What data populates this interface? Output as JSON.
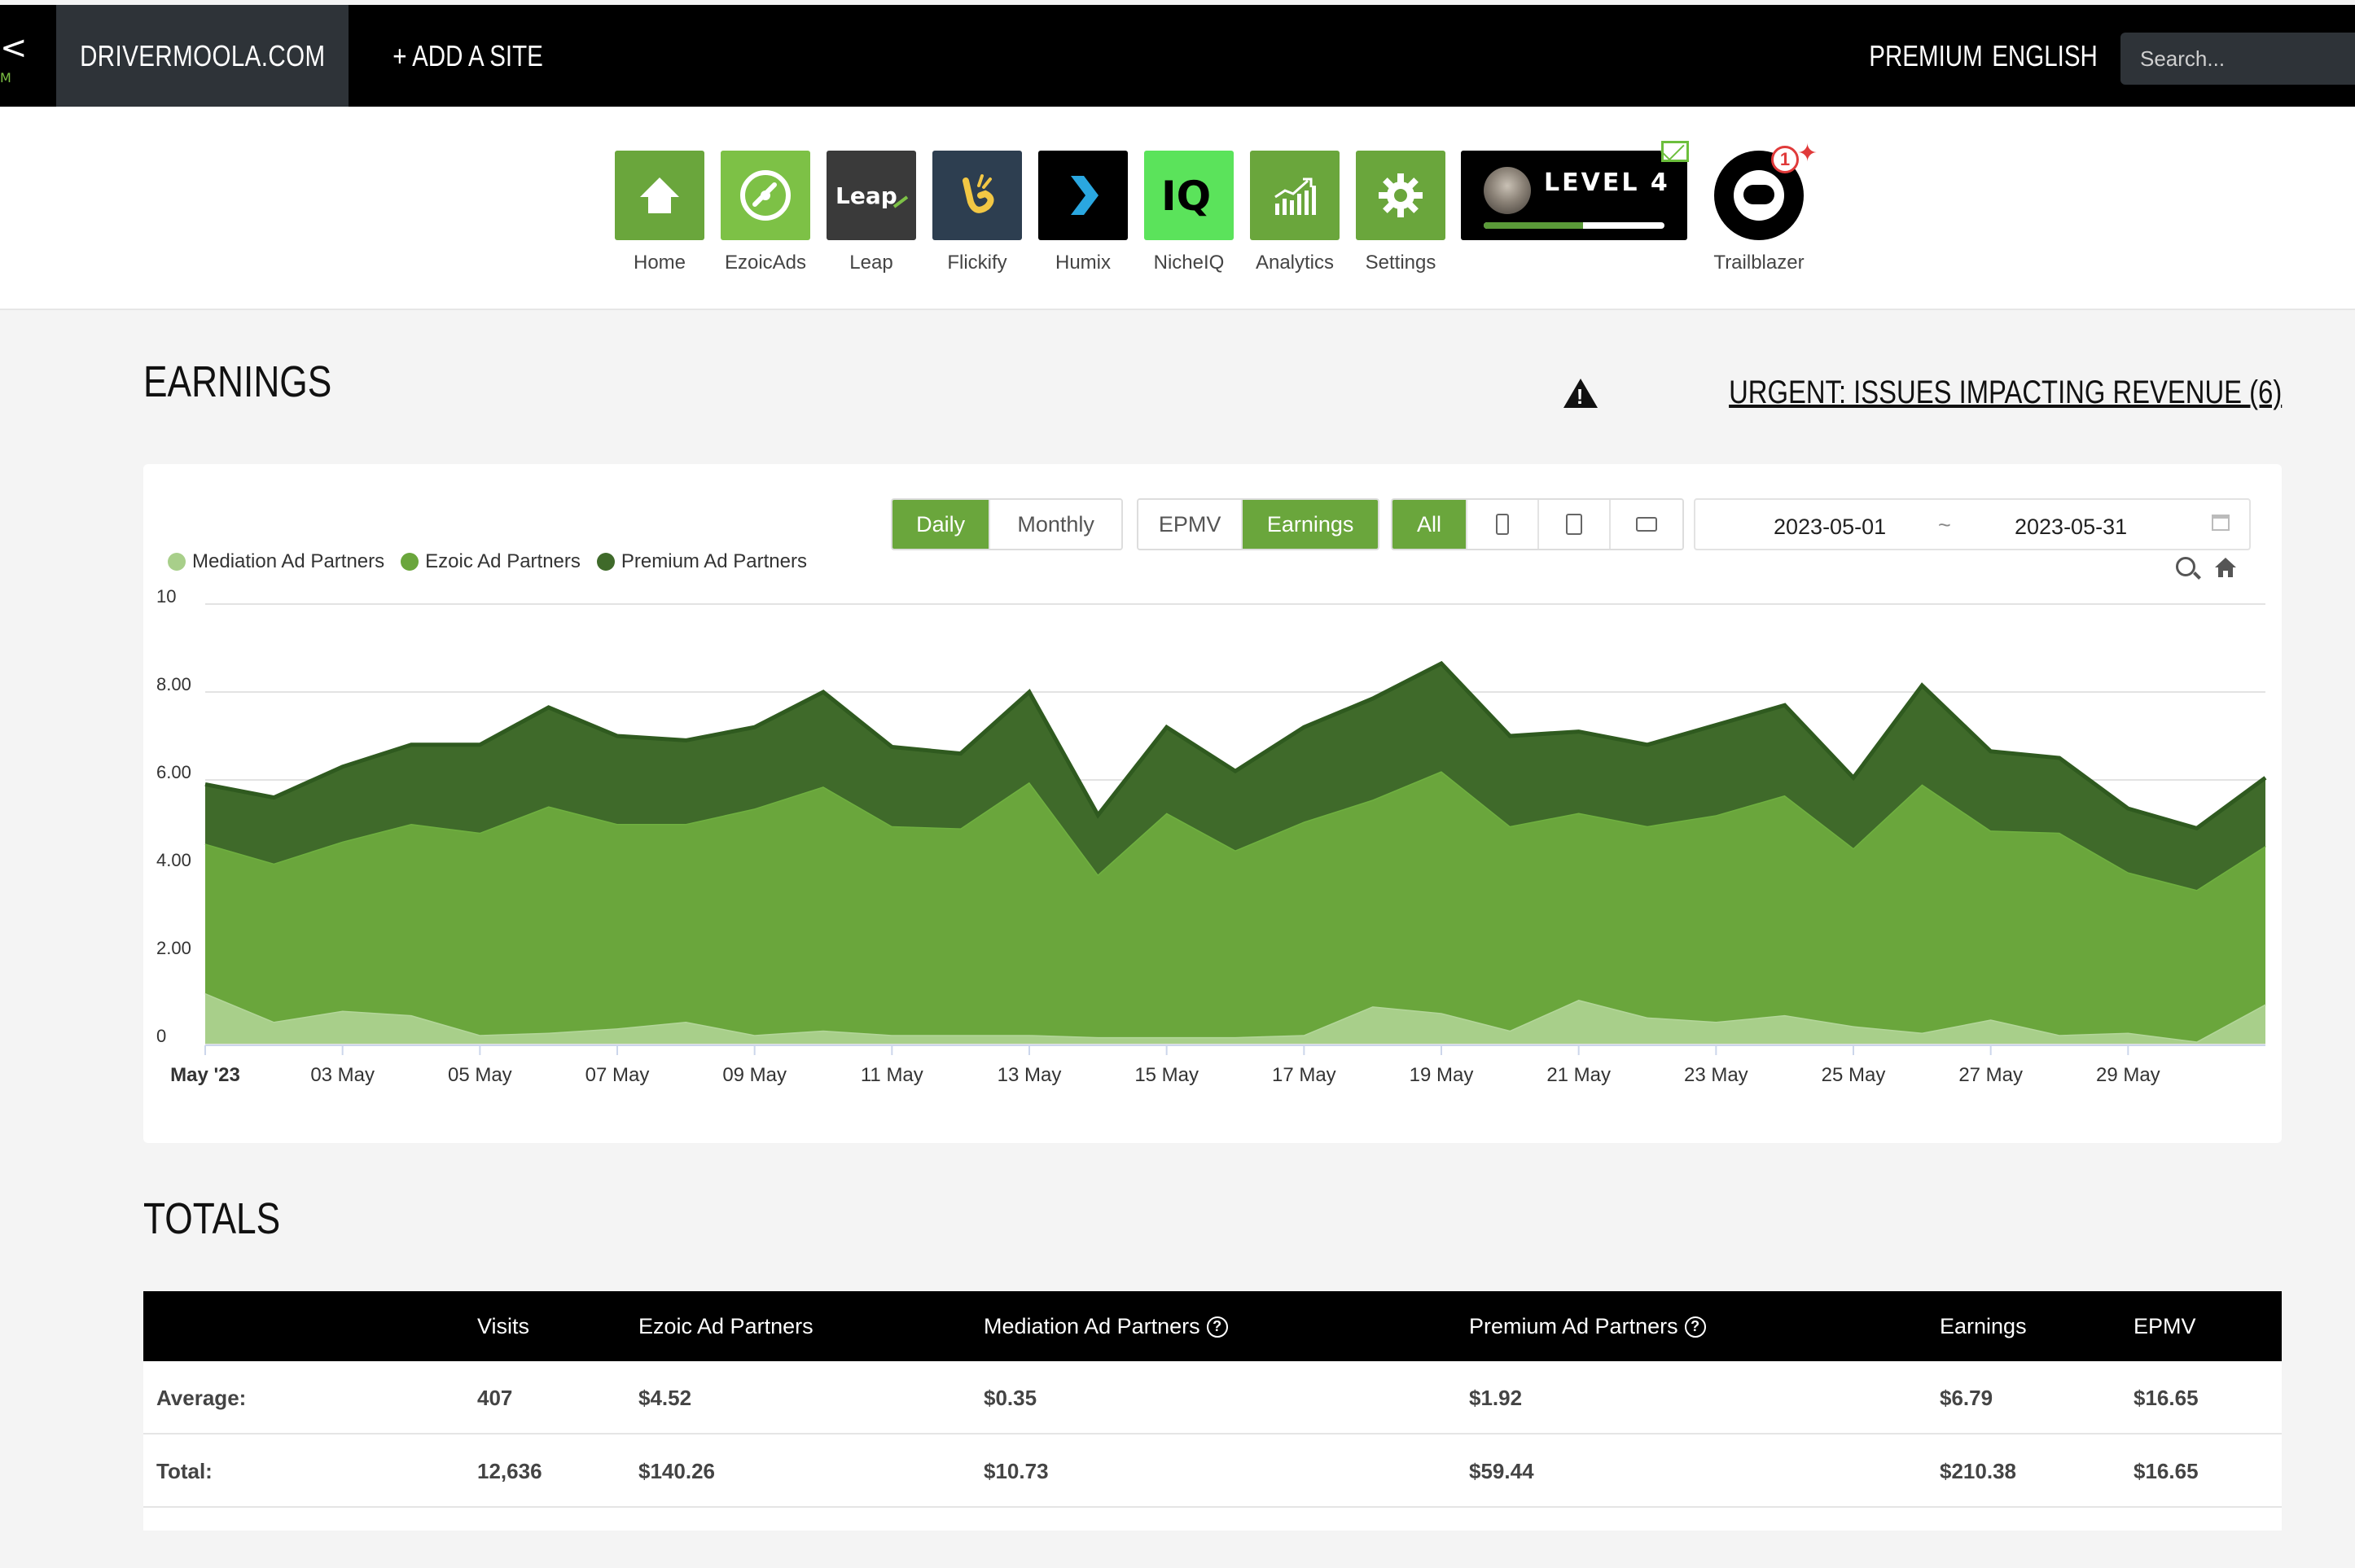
{
  "nav": {
    "site_name": "DRIVERMOOLA.COM",
    "add_site": "+ ADD A SITE",
    "premium": "PREMIUM",
    "language": "ENGLISH",
    "search_placeholder": "Search..."
  },
  "apps": [
    {
      "label": "Home",
      "icon": "home-icon",
      "color": "#6aa63c"
    },
    {
      "label": "EzoicAds",
      "icon": "ezoicads-icon",
      "color": "#7dc146"
    },
    {
      "label": "Leap",
      "icon": "leap-icon",
      "color": "#3a3a3a"
    },
    {
      "label": "Flickify",
      "icon": "flickify-icon",
      "color": "#2d3e50"
    },
    {
      "label": "Humix",
      "icon": "humix-icon",
      "color": "#000000"
    },
    {
      "label": "NicheIQ",
      "icon": "nicheiq-icon",
      "color": "#5be35b"
    },
    {
      "label": "Analytics",
      "icon": "analytics-icon",
      "color": "#6aa63c"
    },
    {
      "label": "Settings",
      "icon": "settings-icon",
      "color": "#6aa63c"
    }
  ],
  "level": {
    "text": "LEVEL 4",
    "progress": 0.55
  },
  "trailblazer": {
    "label": "Trailblazer",
    "notification_count": "1"
  },
  "earnings": {
    "title": "EARNINGS",
    "urgent": "URGENT: ISSUES IMPACTING REVENUE (6)",
    "period_buttons": [
      "Daily",
      "Monthly"
    ],
    "period_active": "Daily",
    "metric_buttons": [
      "EPMV",
      "Earnings"
    ],
    "metric_active": "Earnings",
    "device_all": "All",
    "date_from": "2023-05-01",
    "date_sep": "~",
    "date_to": "2023-05-31"
  },
  "chart_data": {
    "type": "area",
    "stacked": true,
    "title": "",
    "xlabel": "",
    "ylabel": "",
    "ylim": [
      0,
      10
    ],
    "yticks": [
      "0",
      "2.00",
      "4.00",
      "6.00",
      "8.00",
      "10"
    ],
    "xtick_labels": [
      "May '23",
      "03 May",
      "05 May",
      "07 May",
      "09 May",
      "11 May",
      "13 May",
      "15 May",
      "17 May",
      "19 May",
      "21 May",
      "23 May",
      "25 May",
      "27 May",
      "29 May"
    ],
    "x": [
      "2023-05-01",
      "2023-05-02",
      "2023-05-03",
      "2023-05-04",
      "2023-05-05",
      "2023-05-06",
      "2023-05-07",
      "2023-05-08",
      "2023-05-09",
      "2023-05-10",
      "2023-05-11",
      "2023-05-12",
      "2023-05-13",
      "2023-05-14",
      "2023-05-15",
      "2023-05-16",
      "2023-05-17",
      "2023-05-18",
      "2023-05-19",
      "2023-05-20",
      "2023-05-21",
      "2023-05-22",
      "2023-05-23",
      "2023-05-24",
      "2023-05-25",
      "2023-05-26",
      "2023-05-27",
      "2023-05-28",
      "2023-05-29",
      "2023-05-30",
      "2023-05-31"
    ],
    "grid": true,
    "legend_position": "top-left",
    "series": [
      {
        "name": "Mediation Ad Partners",
        "color": "#a8cf8a",
        "values": [
          1.15,
          0.5,
          0.75,
          0.65,
          0.2,
          0.25,
          0.35,
          0.5,
          0.2,
          0.3,
          0.2,
          0.2,
          0.2,
          0.15,
          0.15,
          0.15,
          0.2,
          0.85,
          0.7,
          0.3,
          1.0,
          0.6,
          0.5,
          0.65,
          0.4,
          0.25,
          0.55,
          0.2,
          0.25,
          0.05,
          0.9
        ]
      },
      {
        "name": "Ezoic Ad Partners",
        "color": "#6aa63c",
        "values": [
          3.4,
          3.6,
          3.85,
          4.35,
          4.6,
          5.15,
          4.65,
          4.5,
          5.15,
          5.55,
          4.75,
          4.7,
          5.75,
          3.7,
          5.1,
          4.25,
          4.85,
          4.7,
          5.5,
          4.65,
          4.25,
          4.35,
          4.7,
          5.0,
          4.05,
          5.65,
          4.3,
          4.6,
          3.65,
          3.45,
          3.6
        ]
      },
      {
        "name": "Premium Ad Partners",
        "color": "#3f6a2a",
        "values": [
          1.35,
          1.5,
          1.7,
          1.8,
          2.0,
          2.25,
          2.0,
          1.9,
          1.85,
          2.15,
          1.8,
          1.7,
          2.05,
          1.35,
          1.95,
          1.8,
          2.15,
          2.3,
          2.45,
          2.05,
          1.85,
          1.85,
          2.05,
          2.05,
          1.6,
          2.25,
          1.8,
          1.7,
          1.45,
          1.4,
          1.55
        ]
      }
    ]
  },
  "totals": {
    "title": "TOTALS",
    "columns": [
      "Visits",
      "Ezoic Ad Partners",
      "Mediation Ad Partners",
      "Premium Ad Partners",
      "Earnings",
      "EPMV"
    ],
    "rows": [
      {
        "label": "Average:",
        "values": [
          "407",
          "$4.52",
          "$0.35",
          "$1.92",
          "$6.79",
          "$16.65"
        ]
      },
      {
        "label": "Total:",
        "values": [
          "12,636",
          "$140.26",
          "$10.73",
          "$59.44",
          "$210.38",
          "$16.65"
        ]
      }
    ]
  }
}
